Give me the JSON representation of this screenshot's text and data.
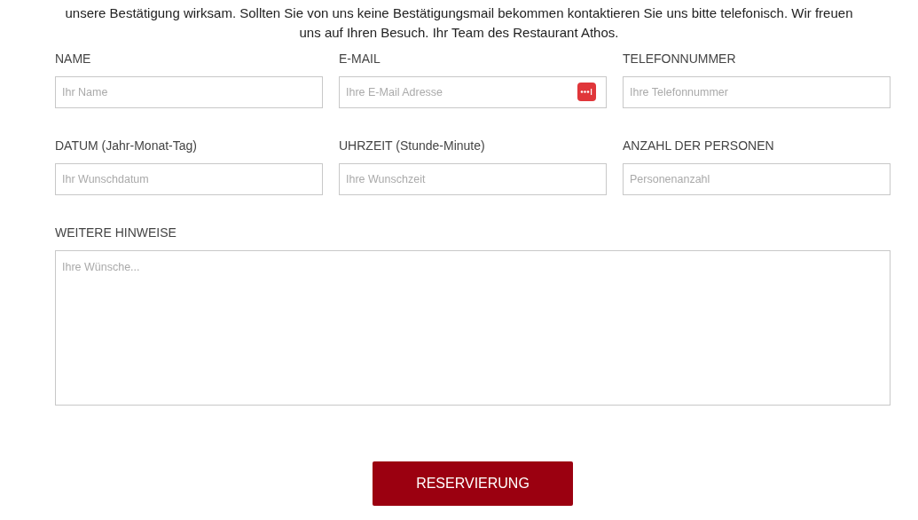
{
  "intro_lines": [
    "unsere Bestätigung wirksam. Sollten Sie von uns keine Bestätigungsmail bekommen kontaktieren Sie uns bitte telefonisch. Wir freuen",
    "uns auf Ihren Besuch. Ihr Team des Restaurant Athos."
  ],
  "fields": [
    {
      "label": "NAME",
      "placeholder": "Ihr Name",
      "kind": "text"
    },
    {
      "label": "E-MAIL",
      "placeholder": "Ihre E-Mail Adresse",
      "kind": "email"
    },
    {
      "label": "TELEFONNUMMER",
      "placeholder": "Ihre Telefonnummer",
      "kind": "text"
    },
    {
      "label": "DATUM (Jahr-Monat-Tag)",
      "placeholder": "Ihr Wunschdatum",
      "kind": "text"
    },
    {
      "label": "UHRZEIT (Stunde-Minute)",
      "placeholder": "Ihre Wunschzeit",
      "kind": "text"
    },
    {
      "label": "ANZAHL DER PERSONEN",
      "placeholder": "Personenanzahl",
      "kind": "text"
    },
    {
      "label": "WEITERE HINWEISE",
      "placeholder": "Ihre Wünsche...",
      "kind": "textarea"
    }
  ],
  "submit_button": "RESERVIERUNG"
}
